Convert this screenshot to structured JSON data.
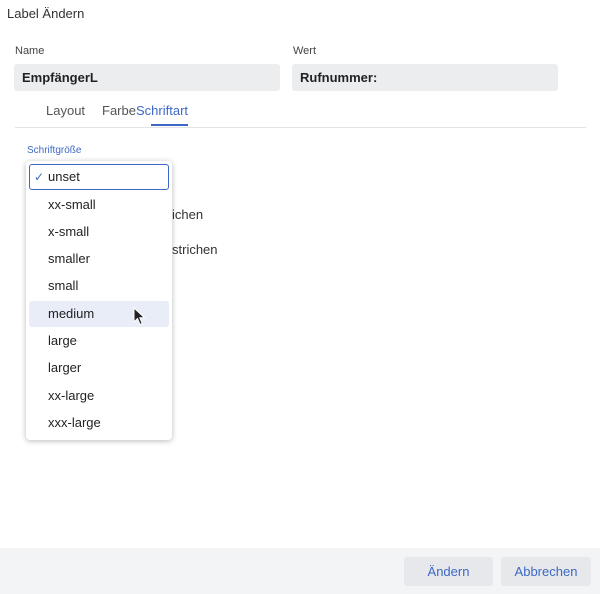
{
  "dialog": {
    "title": "Label Ändern"
  },
  "fields": {
    "name": {
      "label": "Name",
      "value": "EmpfängerL"
    },
    "wert": {
      "label": "Wert",
      "value": "Rufnummer:"
    }
  },
  "tabs": [
    {
      "label": "Layout"
    },
    {
      "label": "Farbe"
    },
    {
      "label": "Schriftart"
    }
  ],
  "font_size": {
    "label": "Schriftgröße",
    "selected": "unset",
    "hovered": "medium",
    "options": [
      "unset",
      "xx-small",
      "x-small",
      "smaller",
      "small",
      "medium",
      "large",
      "larger",
      "xx-large",
      "xxx-large"
    ]
  },
  "background_text": {
    "line1": "ichen",
    "line2": "strichen"
  },
  "footer": {
    "apply_label": "Ändern",
    "cancel_label": "Abbrechen"
  },
  "colors": {
    "accent": "#3d68c6",
    "input_bg": "#ecedef",
    "hover_bg": "#e8edf8"
  }
}
